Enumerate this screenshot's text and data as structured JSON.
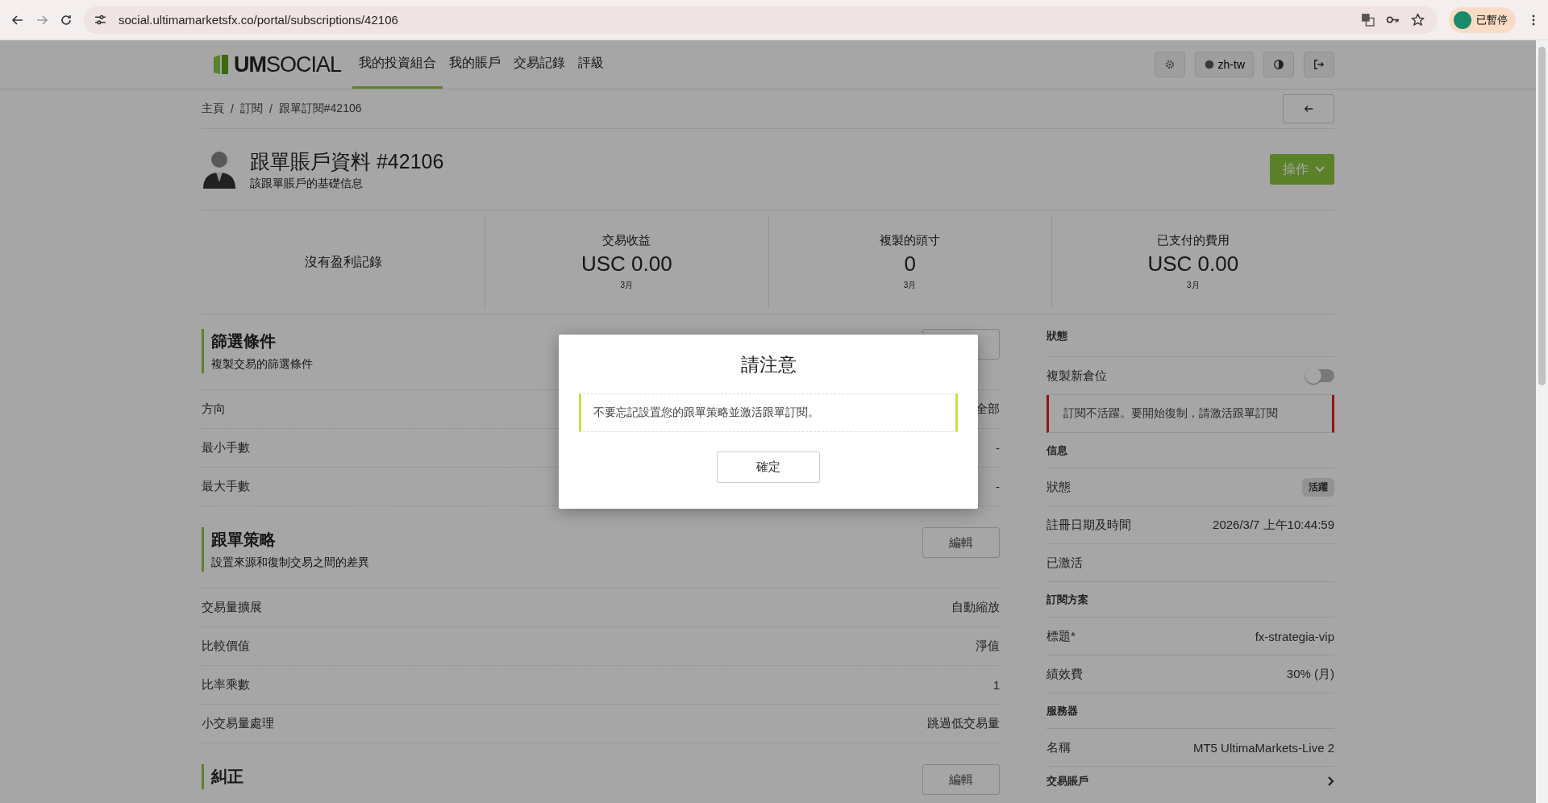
{
  "browser": {
    "url": "social.ultimamarketsfx.co/portal/subscriptions/42106",
    "profile_label": "已暫停"
  },
  "nav": {
    "logo_mark": "UM",
    "logo_text": "SOCIAL",
    "items": [
      {
        "label": "我的投資組合",
        "selected": true
      },
      {
        "label": "我的賬戶",
        "selected": false
      },
      {
        "label": "交易記錄",
        "selected": false
      },
      {
        "label": "評級",
        "selected": false
      }
    ],
    "language": "zh-tw"
  },
  "breadcrumb": {
    "separator": "/",
    "items": [
      "主頁",
      "訂閱",
      "跟單訂閱#42106"
    ]
  },
  "header": {
    "title": "跟單賬戶資料 #42106",
    "subtitle": "該跟單賬戶的基礎信息",
    "action": "操作"
  },
  "stats": [
    {
      "kind": "empty",
      "label": "沒有盈利記錄"
    },
    {
      "kind": "value",
      "label": "交易收益",
      "value": "USC 0.00",
      "period": "3月"
    },
    {
      "kind": "value",
      "label": "複製的頭寸",
      "value": "0",
      "period": "3月"
    },
    {
      "kind": "value",
      "label": "已支付的費用",
      "value": "USC 0.00",
      "period": "3月"
    }
  ],
  "sections": [
    {
      "title": "篩選條件",
      "subtitle": "複製交易的篩選條件",
      "rows": [
        {
          "label": "方向",
          "value": "全部"
        },
        {
          "label": "最小手數",
          "value": "-"
        },
        {
          "label": "最大手數",
          "value": "-"
        }
      ]
    },
    {
      "title": "跟單策略",
      "subtitle": "設置來源和復制交易之間的差異",
      "button": "編輯",
      "rows": [
        {
          "label": "交易量擴展",
          "value": "自動縮放"
        },
        {
          "label": "比較價值",
          "value": "淨值"
        },
        {
          "label": "比率乘數",
          "value": "1"
        },
        {
          "label": "小交易量處理",
          "value": "跳過低交易量"
        }
      ]
    },
    {
      "title": "糾正",
      "button": "編輯"
    }
  ],
  "side": [
    {
      "kind": "heading",
      "label": "狀態"
    },
    {
      "kind": "toggle",
      "label": "複製新倉位",
      "on": false
    },
    {
      "kind": "alert",
      "label": "訂閱不活躍。要開始復制，請激活跟單訂閱"
    },
    {
      "kind": "heading",
      "label": "信息"
    },
    {
      "kind": "badge",
      "label": "狀態",
      "value": "活躍"
    },
    {
      "kind": "row",
      "label": "註冊日期及時間",
      "value": "2026/3/7 上午10:44:59"
    },
    {
      "kind": "row",
      "label": "已激活"
    },
    {
      "kind": "heading",
      "label": "訂閱方案"
    },
    {
      "kind": "row",
      "label": "標題*",
      "value": "fx-strategia-vip"
    },
    {
      "kind": "row",
      "label": "績效費",
      "value": "30% (月)"
    },
    {
      "kind": "heading",
      "label": "服務器"
    },
    {
      "kind": "row",
      "label": "名稱",
      "value": "MT5 UltimaMarkets-Live 2"
    },
    {
      "kind": "link",
      "label": "交易賬戶"
    }
  ],
  "modal": {
    "title": "請注意",
    "message": "不要忘記設置您的跟單策略並激活跟單訂閱。",
    "button": "確定"
  }
}
